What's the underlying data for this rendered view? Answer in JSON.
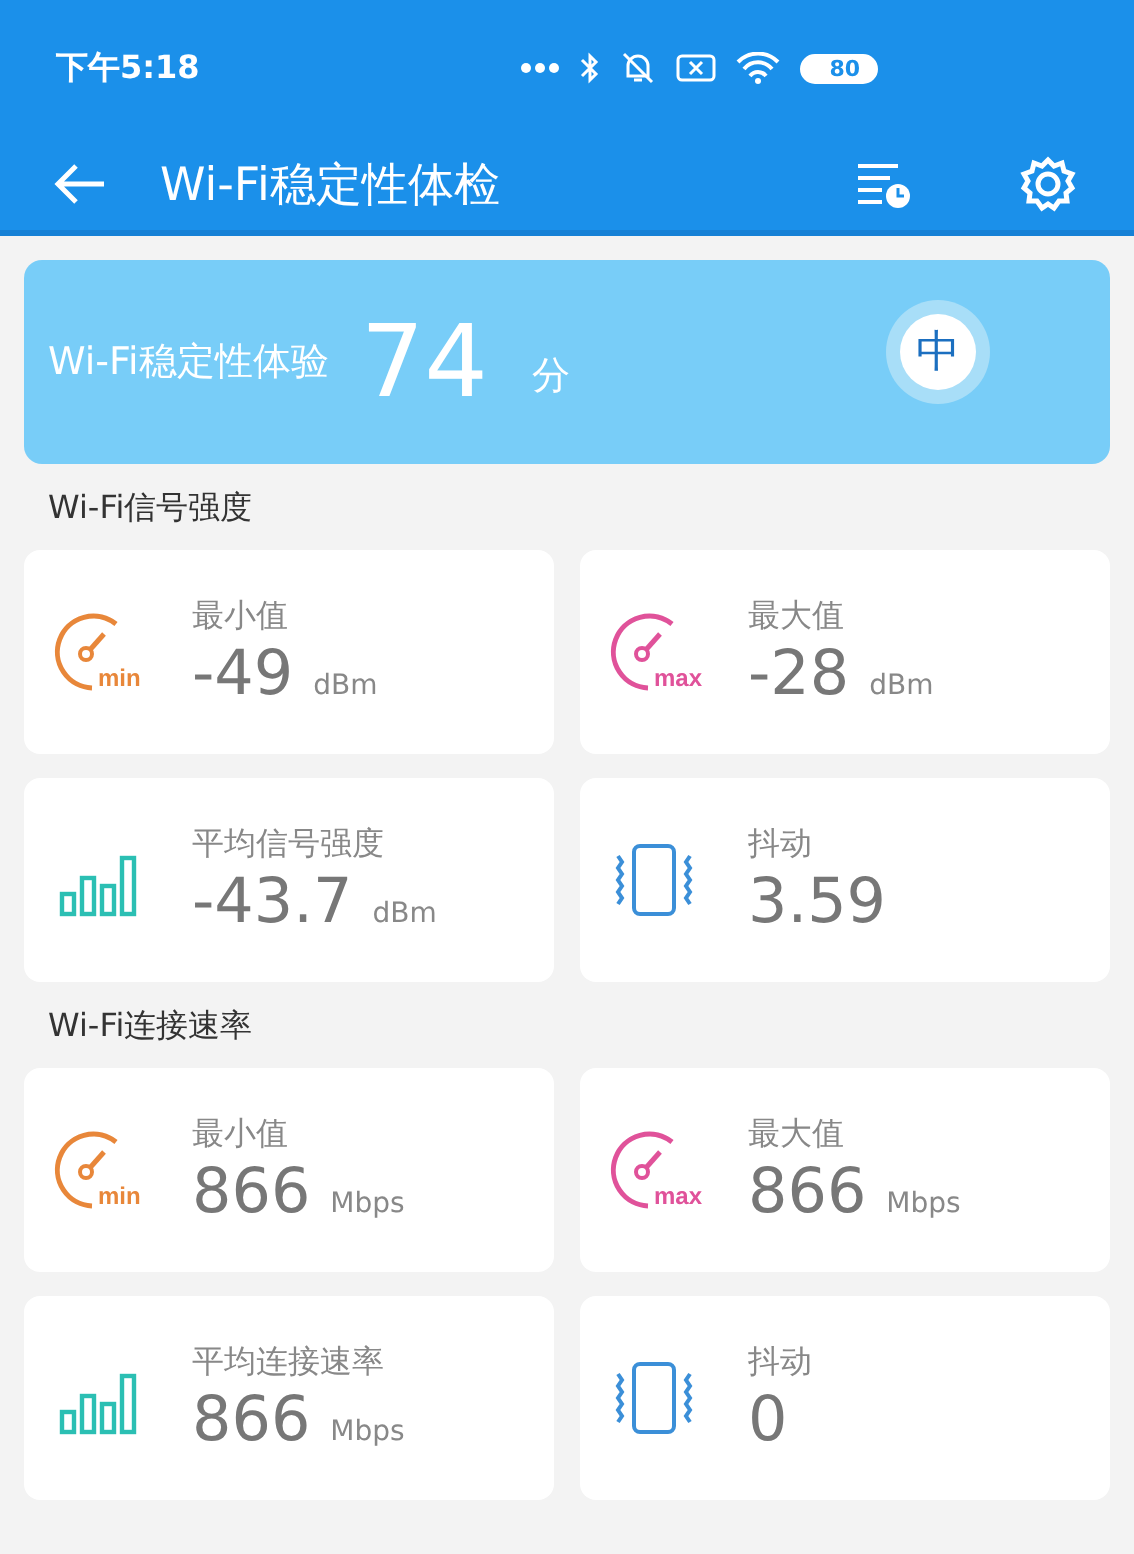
{
  "status_bar": {
    "time": "下午5:18",
    "battery": "80"
  },
  "app_bar": {
    "title": "Wi-Fi稳定性体检"
  },
  "score": {
    "label": "Wi-Fi稳定性体验",
    "value": "74",
    "unit": "分",
    "grade": "中"
  },
  "sections": [
    {
      "title": "Wi-Fi信号强度",
      "metrics": [
        {
          "kind": "min",
          "badge": "min",
          "label": "最小值",
          "value": "-49",
          "unit": "dBm"
        },
        {
          "kind": "max",
          "badge": "max",
          "label": "最大值",
          "value": "-28",
          "unit": "dBm"
        },
        {
          "kind": "bars",
          "label": "平均信号强度",
          "value": "-43.7",
          "unit": "dBm"
        },
        {
          "kind": "jitter",
          "label": "抖动",
          "value": "3.59"
        }
      ]
    },
    {
      "title": "Wi-Fi连接速率",
      "metrics": [
        {
          "kind": "min",
          "badge": "min",
          "label": "最小值",
          "value": "866",
          "unit": "Mbps"
        },
        {
          "kind": "max",
          "badge": "max",
          "label": "最大值",
          "value": "866",
          "unit": "Mbps"
        },
        {
          "kind": "bars",
          "label": "平均连接速率",
          "value": "866",
          "unit": "Mbps"
        },
        {
          "kind": "jitter",
          "label": "抖动",
          "value": "0"
        }
      ]
    }
  ]
}
